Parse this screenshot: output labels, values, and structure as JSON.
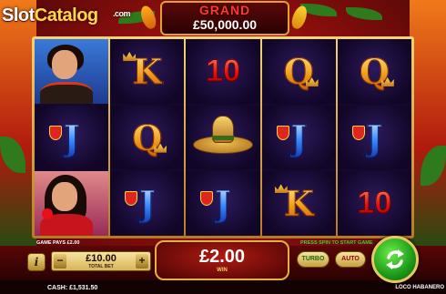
{
  "header": {
    "logo_main": "Slot",
    "logo_accent": "Catalog",
    "logo_suffix": ".com",
    "jackpot_label": "GRAND",
    "jackpot_amount": "£50,000.00"
  },
  "reels": [
    [
      {
        "symbol": "portrait-man"
      },
      {
        "symbol": "J"
      },
      {
        "symbol": "portrait-woman"
      }
    ],
    [
      {
        "symbol": "K"
      },
      {
        "symbol": "Q"
      },
      {
        "symbol": "J"
      }
    ],
    [
      {
        "symbol": "10"
      },
      {
        "symbol": "sombrero"
      },
      {
        "symbol": "J"
      }
    ],
    [
      {
        "symbol": "Q"
      },
      {
        "symbol": "J"
      },
      {
        "symbol": "K"
      }
    ],
    [
      {
        "symbol": "Q"
      },
      {
        "symbol": "J"
      },
      {
        "symbol": "10"
      }
    ]
  ],
  "controls": {
    "game_pays": "GAME PAYS £2.00",
    "press_spin": "PRESS SPIN TO START GAME",
    "info_label": "i",
    "minus_label": "−",
    "plus_label": "+",
    "bet_value": "£10.00",
    "bet_label": "TOTAL BET",
    "win_value": "£2.00",
    "win_label": "WIN",
    "turbo_label": "TURBO",
    "auto_label": "AUTO",
    "cash_label": "CASH:",
    "cash_value": "£1,531.50",
    "game_name": "LOCO HABANERO"
  },
  "colors": {
    "frame_gold": "#e0a232",
    "spin_green": "#1c9a18",
    "jackpot_red": "#ff3a2a"
  }
}
